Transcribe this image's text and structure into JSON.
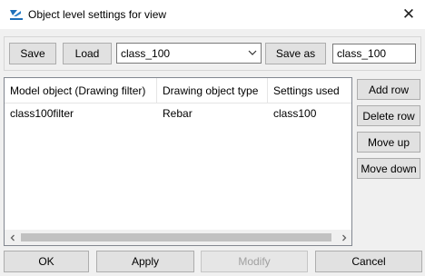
{
  "window": {
    "title": "Object level settings for view"
  },
  "toolbar": {
    "save_label": "Save",
    "load_label": "Load",
    "selected_settings": "class_100",
    "save_as_label": "Save as",
    "save_as_value": "class_100"
  },
  "table": {
    "columns": [
      "Model object (Drawing filter)",
      "Drawing object type",
      "Settings used"
    ],
    "rows": [
      [
        "class100filter",
        "Rebar",
        "class100"
      ]
    ]
  },
  "side_buttons": {
    "add_row": "Add row",
    "delete_row": "Delete row",
    "move_up": "Move up",
    "move_down": "Move down"
  },
  "footer": {
    "ok": "OK",
    "apply": "Apply",
    "modify": "Modify",
    "cancel": "Cancel"
  },
  "colors": {
    "accent": "#1e6fb8",
    "button_face": "#e1e1e1",
    "window_bg": "#f0f0f0"
  }
}
